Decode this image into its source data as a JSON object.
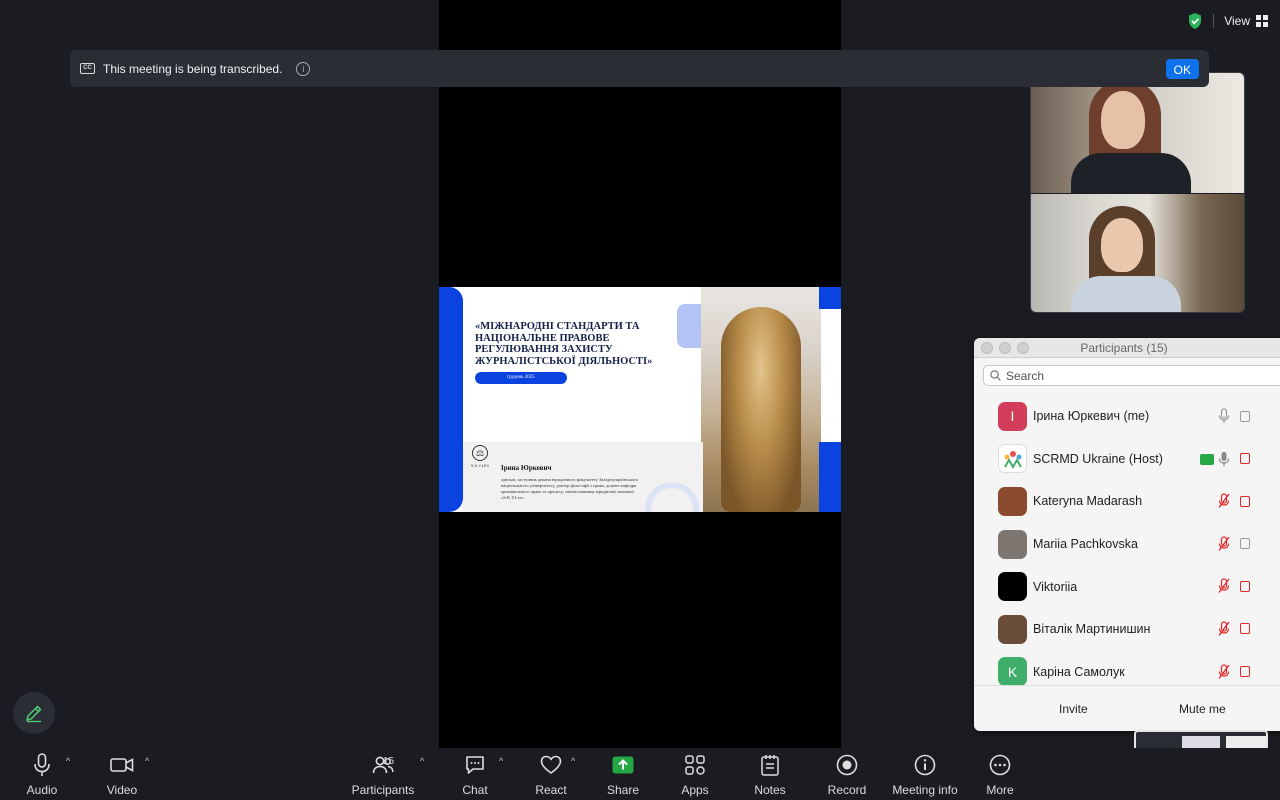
{
  "topbar": {
    "view_label": "View"
  },
  "banner": {
    "text": "This meeting is being transcribed.",
    "cc": "CC",
    "ok": "OK"
  },
  "slide": {
    "title": "«МІЖНАРОДНІ СТАНДАРТИ ТА НАЦІОНАЛЬНЕ ПРАВОВЕ РЕГУЛЮВАННЯ ЗАХИСТУ ЖУРНАЛІСТСЬКОЇ ДІЯЛЬНОСТІ»",
    "date": "грудень 2025",
    "logo_text": "S.K.Y.LEX",
    "speaker": "Ірина Юркевич",
    "bio": "адвокат, заступник декана юридичного факультету Західноукраїнського національного університету, доктор філософії з права, доцент кафедри кримінального права та процесу, співзасновниця юридичної компанії «S.K.Y.Lex»"
  },
  "participants": {
    "title": "Participants (15)",
    "search_placeholder": "Search",
    "list": [
      {
        "name": "Ірина Юркевич (me)",
        "initial": "I",
        "color": "#d23d5b",
        "mic": "on",
        "video": "off"
      },
      {
        "name": "SCRMD Ukraine (Host)",
        "initial": "",
        "color": "#ffffff",
        "mic": "on",
        "video": "red",
        "sharing": true
      },
      {
        "name": "Kateryna Madarash",
        "initial": "",
        "color": "#8a4b2f",
        "mic": "muted",
        "video": "red"
      },
      {
        "name": "Mariia Pachkovska",
        "initial": "",
        "color": "#7d7570",
        "mic": "muted",
        "video": "off"
      },
      {
        "name": "Viktoriia",
        "initial": "",
        "color": "#000000",
        "mic": "muted",
        "video": "red"
      },
      {
        "name": "Віталік Мартинишин",
        "initial": "",
        "color": "#6a4c3a",
        "mic": "muted",
        "video": "red"
      },
      {
        "name": "Каріна Самолук",
        "initial": "K",
        "color": "#3fae6a",
        "mic": "muted",
        "video": "red"
      }
    ],
    "invite": "Invite",
    "mute_me": "Mute me"
  },
  "toolbar": {
    "audio": "Audio",
    "video": "Video",
    "participants": "Participants",
    "participants_count": "15",
    "chat": "Chat",
    "react": "React",
    "share": "Share",
    "apps": "Apps",
    "notes": "Notes",
    "record": "Record",
    "meeting_info": "Meeting info",
    "more": "More"
  },
  "colors": {
    "accent": "#0e72ed",
    "share_green": "#25a745",
    "muted_red": "#e02828"
  }
}
